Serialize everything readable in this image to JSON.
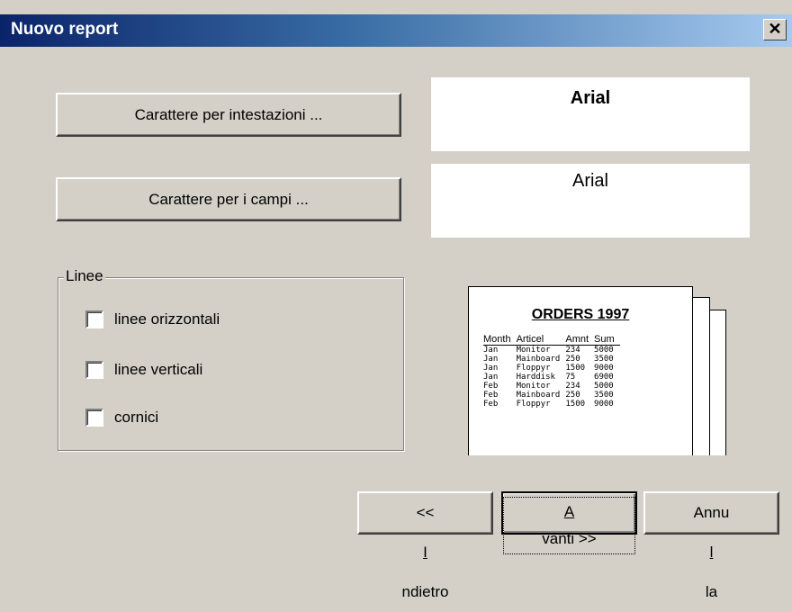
{
  "window": {
    "title": "Nuovo report",
    "close_label": "✕"
  },
  "buttons": {
    "header_font": "Carattere per intestazioni ...",
    "field_font": "Carattere per i campi ...",
    "back_prefix": "<< ",
    "back_accel": "I",
    "back_rest": "ndietro",
    "next_accel": "A",
    "next_rest": "vanti >>",
    "cancel_pre": "Annu",
    "cancel_accel": "l",
    "cancel_rest": "la"
  },
  "font_previews": {
    "header_font_name": "Arial",
    "field_font_name": "Arial"
  },
  "lines_group": {
    "label": "Linee",
    "options": [
      {
        "label": "linee orizzontali",
        "checked": false
      },
      {
        "label": "linee verticali",
        "checked": false
      },
      {
        "label": "cornici",
        "checked": false
      }
    ]
  },
  "preview": {
    "title": "ORDERS 1997",
    "columns": [
      "Month",
      "Articel",
      "Amnt",
      "Sum"
    ],
    "rows": [
      [
        "Jan",
        "Monitor",
        "234",
        "5000"
      ],
      [
        "Jan",
        "Mainboard",
        "250",
        "3500"
      ],
      [
        "Jan",
        "Floppyr",
        "1500",
        "9000"
      ],
      [
        "Jan",
        "Harddisk",
        "75",
        "6900"
      ],
      [
        "Feb",
        "Monitor",
        "234",
        "5000"
      ],
      [
        "Feb",
        "Mainboard",
        "250",
        "3500"
      ],
      [
        "Feb",
        "Floppyr",
        "1500",
        "9000"
      ]
    ]
  }
}
